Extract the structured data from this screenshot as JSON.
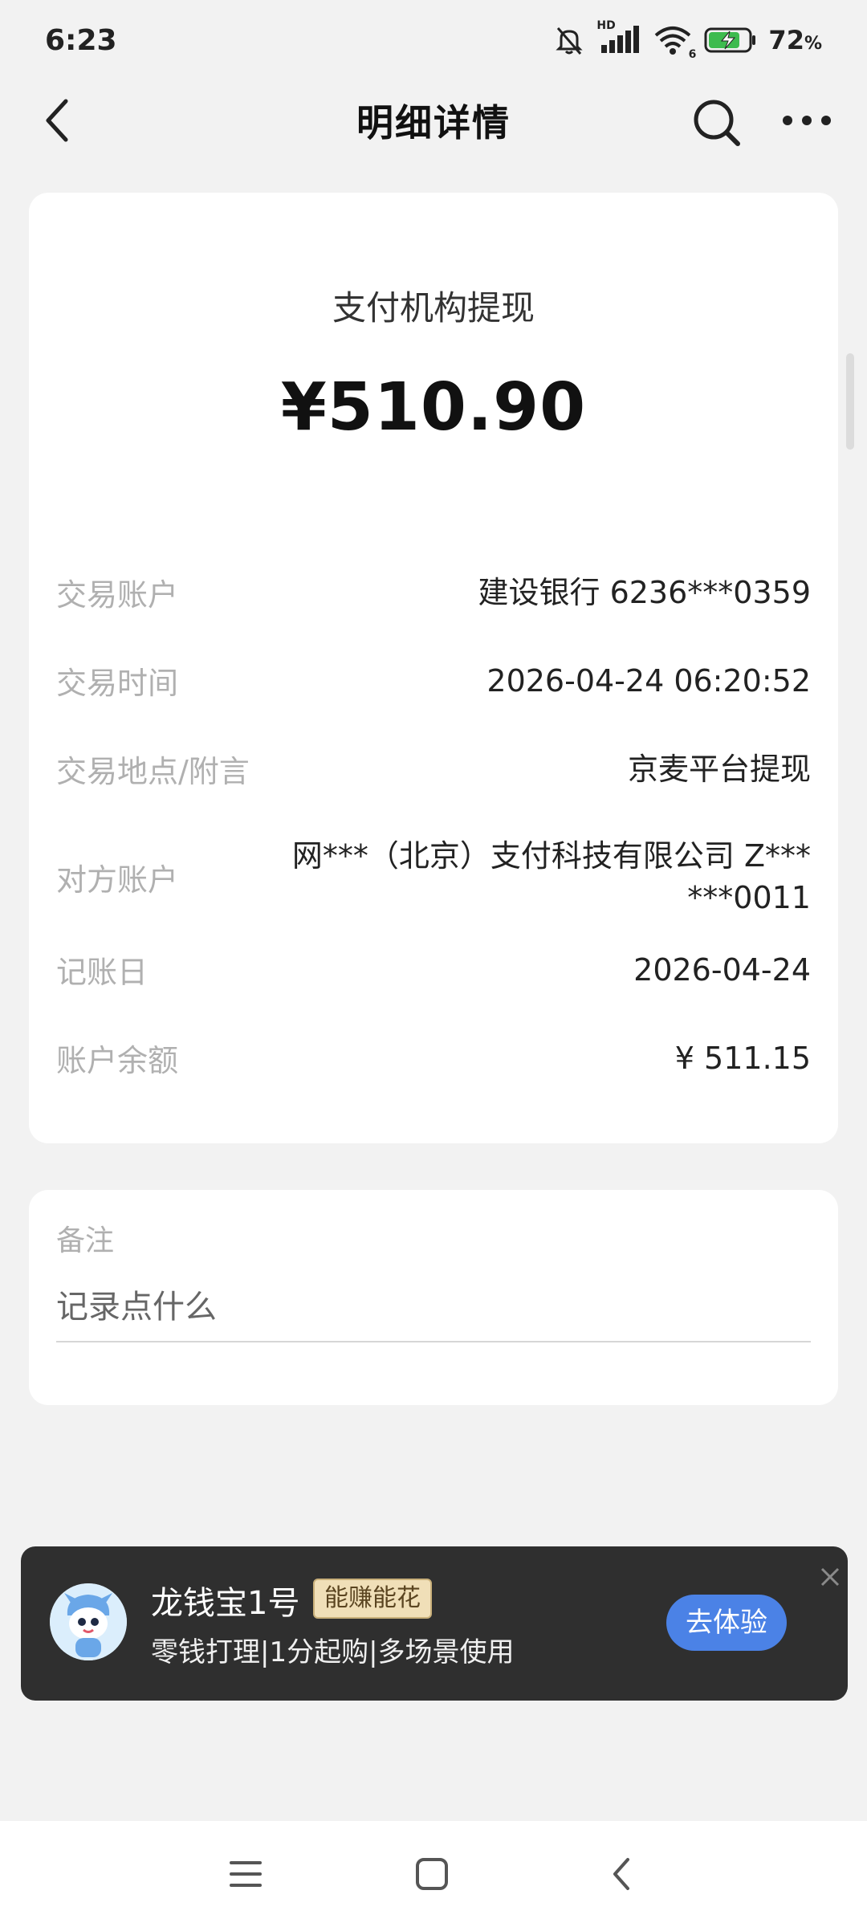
{
  "status_bar": {
    "time": "6:23",
    "network_label": "HD",
    "wifi_label": "6",
    "battery": "72",
    "battery_unit": "%"
  },
  "header": {
    "title": "明细详情",
    "back_icon": "chevron-left-icon",
    "search_icon": "search-icon",
    "more_icon": "more-horizontal-icon"
  },
  "transaction": {
    "type": "支付机构提现",
    "amount": "¥510.90",
    "rows": [
      {
        "label": "交易账户",
        "value": "建设银行 6236***0359"
      },
      {
        "label": "交易时间",
        "value": "2026-04-24 06:20:52"
      },
      {
        "label": "交易地点/附言",
        "value": "京麦平台提现"
      },
      {
        "label": "对方账户",
        "value": "网***（北京）支付科技有限公司 Z*** ***0011"
      },
      {
        "label": "记账日",
        "value": "2026-04-24"
      },
      {
        "label": "账户余额",
        "value": "¥ 511.15"
      }
    ]
  },
  "remark": {
    "title": "备注",
    "placeholder": "记录点什么"
  },
  "promo": {
    "title": "龙钱宝1号",
    "badge": "能赚能花",
    "description": "零钱打理|1分起购|多场景使用",
    "cta": "去体验"
  },
  "colors": {
    "background": "#f2f2f2",
    "card": "#ffffff",
    "label_gray": "#b0b0b0",
    "promo_bg": "#2f2f2f",
    "cta_blue": "#4b82e6",
    "badge_gold": "#f0dfb8"
  }
}
